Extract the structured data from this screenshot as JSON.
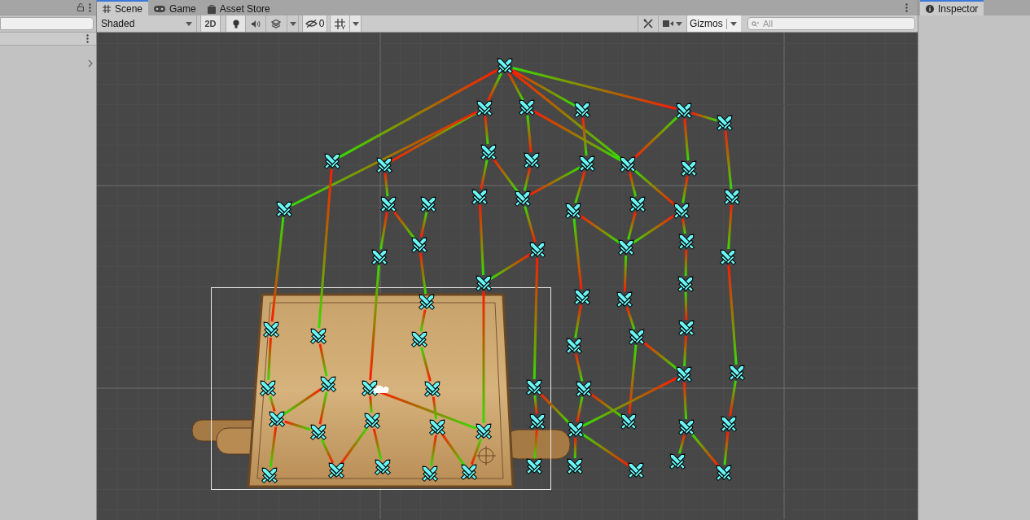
{
  "scene_tabs": [
    {
      "label": "Scene",
      "selected": true
    },
    {
      "label": "Game",
      "selected": false
    },
    {
      "label": "Asset Store",
      "selected": false
    }
  ],
  "scene_toolbar": {
    "draw_mode": "Shaded",
    "mode_2d": "2D",
    "hidden_count": "0",
    "gizmos": "Gizmos",
    "search": {
      "placeholder": "All"
    }
  },
  "inspector_tabs": [
    {
      "label": "Inspector",
      "selected": true
    }
  ]
}
